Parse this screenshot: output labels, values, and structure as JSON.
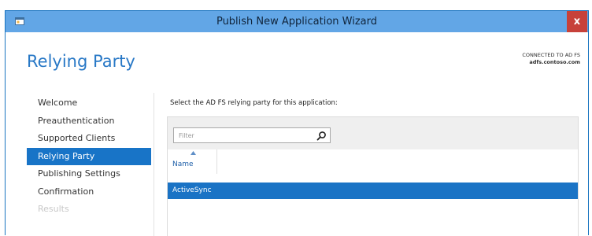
{
  "window": {
    "title": "Publish New Application Wizard",
    "close_label": "x",
    "icon": "wizard-app-icon"
  },
  "page": {
    "heading": "Relying Party",
    "connection_caption": "CONNECTED TO AD FS",
    "connection_host": "adfs.contoso.com"
  },
  "nav": {
    "items": [
      {
        "label": "Welcome",
        "state": "normal"
      },
      {
        "label": "Preauthentication",
        "state": "normal"
      },
      {
        "label": "Supported Clients",
        "state": "normal"
      },
      {
        "label": "Relying Party",
        "state": "active"
      },
      {
        "label": "Publishing Settings",
        "state": "normal"
      },
      {
        "label": "Confirmation",
        "state": "normal"
      },
      {
        "label": "Results",
        "state": "disabled"
      }
    ]
  },
  "main": {
    "instruction": "Select the AD FS relying party for this application:",
    "filter": {
      "placeholder": "Filter",
      "value": "",
      "icon": "search-icon"
    },
    "table": {
      "columns": [
        "Name"
      ],
      "sort": "ascending",
      "rows": [
        {
          "name": "ActiveSync",
          "selected": true
        }
      ]
    }
  },
  "colors": {
    "accent": "#1874c7",
    "titlebar": "#62a6e6",
    "close": "#c7413a",
    "heading": "#2878c6"
  }
}
